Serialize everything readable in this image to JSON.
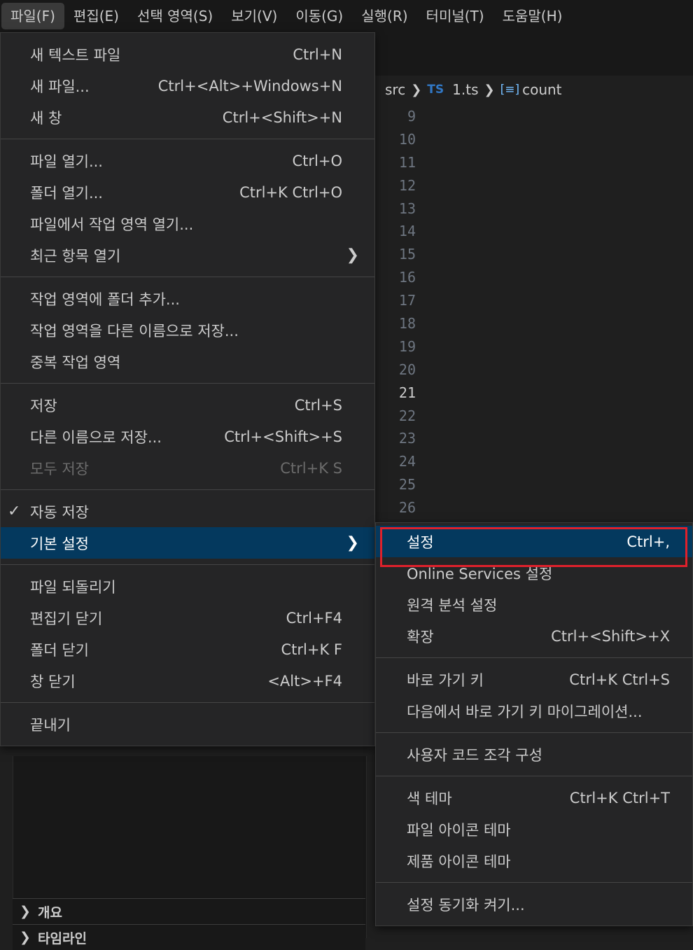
{
  "menubar": {
    "items": [
      "파일(F)",
      "편집(E)",
      "선택 영역(S)",
      "보기(V)",
      "이동(G)",
      "실행(R)",
      "터미널(T)",
      "도움말(H)"
    ]
  },
  "breadcrumb": {
    "folder": "src",
    "lang_badge": "TS",
    "file": "1.ts",
    "symbol": "count"
  },
  "line_numbers": [
    "9",
    "10",
    "11",
    "12",
    "13",
    "14",
    "15",
    "16",
    "17",
    "18",
    "19",
    "20",
    "21",
    "22",
    "23",
    "24",
    "25",
    "26"
  ],
  "current_line": "21",
  "sidebar": {
    "outline_label": "개요",
    "timeline_label": "타임라인"
  },
  "file_menu": {
    "groups": [
      [
        {
          "label": "새 텍스트 파일",
          "shortcut": "Ctrl+N"
        },
        {
          "label": "새 파일...",
          "shortcut": "Ctrl+<Alt>+Windows+N"
        },
        {
          "label": "새 창",
          "shortcut": "Ctrl+<Shift>+N"
        }
      ],
      [
        {
          "label": "파일 열기...",
          "shortcut": "Ctrl+O"
        },
        {
          "label": "폴더 열기...",
          "shortcut": "Ctrl+K Ctrl+O"
        },
        {
          "label": "파일에서 작업 영역 열기...",
          "shortcut": ""
        },
        {
          "label": "최근 항목 열기",
          "shortcut": "",
          "submenu": true
        }
      ],
      [
        {
          "label": "작업 영역에 폴더 추가...",
          "shortcut": ""
        },
        {
          "label": "작업 영역을 다른 이름으로 저장...",
          "shortcut": ""
        },
        {
          "label": "중복 작업 영역",
          "shortcut": ""
        }
      ],
      [
        {
          "label": "저장",
          "shortcut": "Ctrl+S"
        },
        {
          "label": "다른 이름으로 저장...",
          "shortcut": "Ctrl+<Shift>+S"
        },
        {
          "label": "모두 저장",
          "shortcut": "Ctrl+K S",
          "disabled": true
        }
      ],
      [
        {
          "label": "자동 저장",
          "shortcut": "",
          "checked": true
        },
        {
          "label": "기본 설정",
          "shortcut": "",
          "submenu": true,
          "highlight": true
        }
      ],
      [
        {
          "label": "파일 되돌리기",
          "shortcut": ""
        },
        {
          "label": "편집기 닫기",
          "shortcut": "Ctrl+F4"
        },
        {
          "label": "폴더 닫기",
          "shortcut": "Ctrl+K F"
        },
        {
          "label": "창 닫기",
          "shortcut": "<Alt>+F4"
        }
      ],
      [
        {
          "label": "끝내기",
          "shortcut": ""
        }
      ]
    ]
  },
  "preferences_menu": {
    "groups": [
      [
        {
          "label": "설정",
          "shortcut": "Ctrl+,",
          "highlight": true
        },
        {
          "label": "Online Services 설정",
          "shortcut": ""
        },
        {
          "label": "원격 분석 설정",
          "shortcut": ""
        },
        {
          "label": "확장",
          "shortcut": "Ctrl+<Shift>+X"
        }
      ],
      [
        {
          "label": "바로 가기 키",
          "shortcut": "Ctrl+K Ctrl+S"
        },
        {
          "label": "다음에서 바로 가기 키 마이그레이션...",
          "shortcut": ""
        }
      ],
      [
        {
          "label": "사용자 코드 조각 구성",
          "shortcut": ""
        }
      ],
      [
        {
          "label": "색 테마",
          "shortcut": "Ctrl+K Ctrl+T"
        },
        {
          "label": "파일 아이콘 테마",
          "shortcut": ""
        },
        {
          "label": "제품 아이콘 테마",
          "shortcut": ""
        }
      ],
      [
        {
          "label": "설정 동기화 켜기...",
          "shortcut": ""
        }
      ]
    ]
  },
  "colors": {
    "highlight": "#04395e",
    "focus_ring": "#e0212b",
    "ts_badge": "#3178c6"
  }
}
